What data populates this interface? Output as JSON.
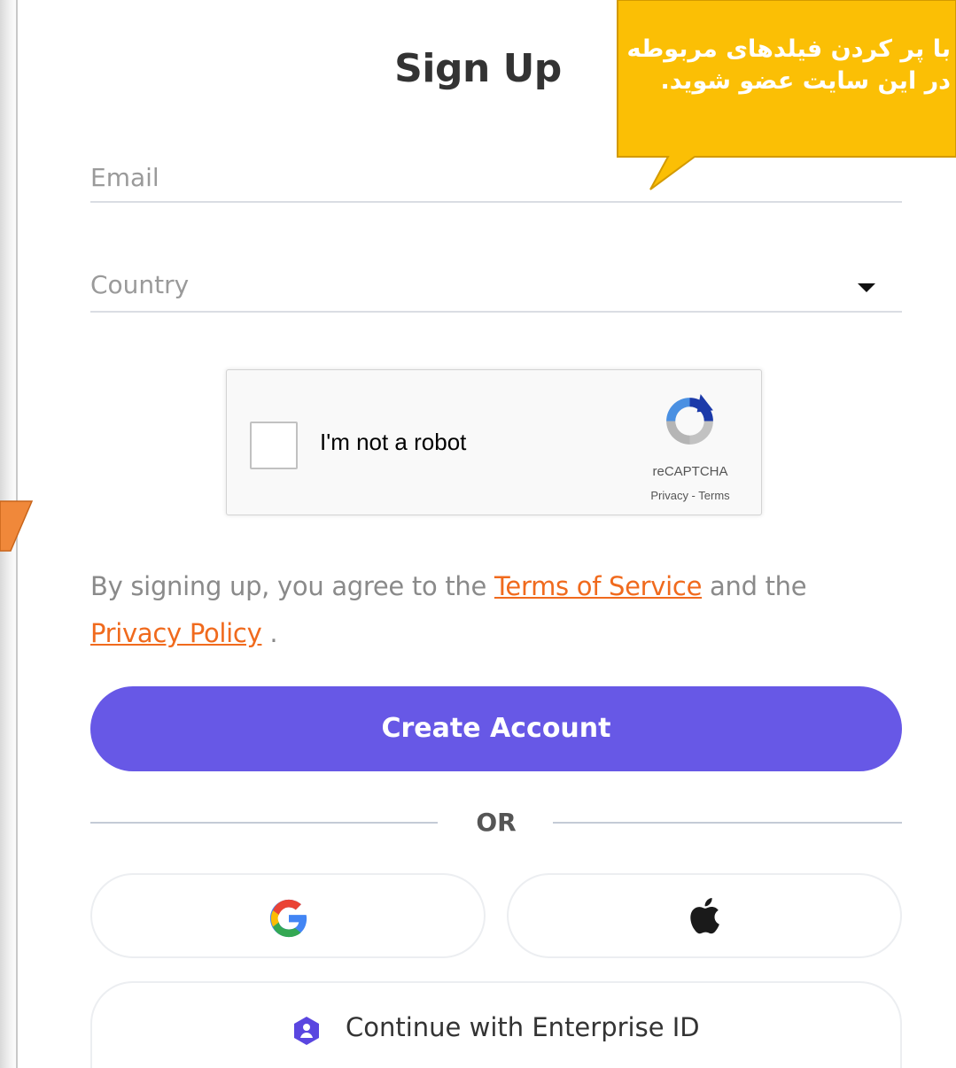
{
  "page": {
    "title": "Sign Up"
  },
  "form": {
    "email_placeholder": "Email",
    "country_placeholder": "Country"
  },
  "captcha": {
    "label": "I'm not a robot",
    "brand": "reCAPTCHA",
    "links": "Privacy - Terms"
  },
  "agreement": {
    "prefix": "By signing up, you agree to the ",
    "terms_link": "Terms of Service",
    "middle": " and the",
    "privacy_link": "Privacy Policy",
    "suffix": " ."
  },
  "buttons": {
    "create_account": "Create Account",
    "or_divider": "OR",
    "enterprise": "Continue with Enterprise ID"
  },
  "annotation": {
    "line1": "با پر کردن فیلدهای مربوطه",
    "line2": "در این سایت عضو شوید."
  },
  "colors": {
    "primary": "#6758e6",
    "link": "#f06a1d",
    "callout": "#fbbf05"
  }
}
